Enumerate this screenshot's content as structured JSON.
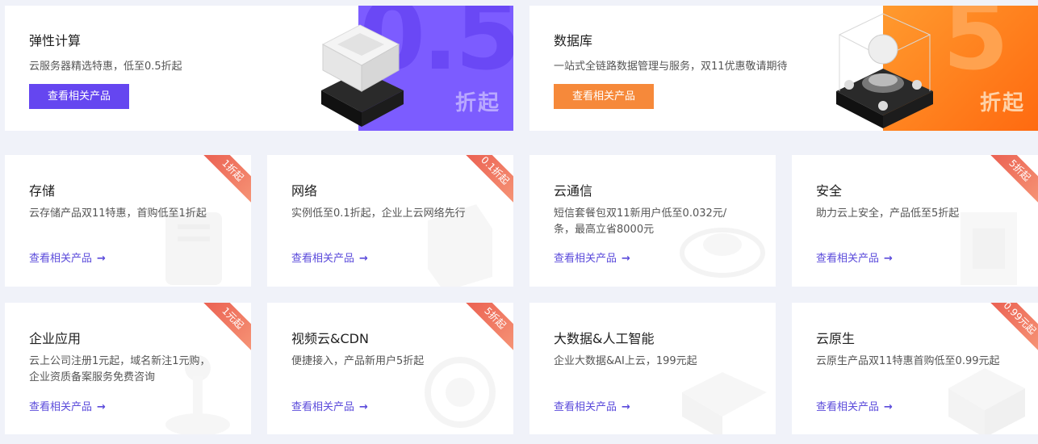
{
  "featured": [
    {
      "title": "弹性计算",
      "desc": "云服务器精选特惠，低至0.5折起",
      "button": "查看相关产品",
      "promo_number": "0.5",
      "promo_suffix": "折起",
      "accent": "#6546f0",
      "promo_bg": "#7c5cff"
    },
    {
      "title": "数据库",
      "desc": "一站式全链路数据管理与服务，双11优惠敬请期待",
      "button": "查看相关产品",
      "promo_number": "5",
      "promo_suffix": "折起",
      "accent": "#f6893a",
      "promo_bg": "#ff7a1f"
    }
  ],
  "products": [
    {
      "title": "存储",
      "desc": "云存储产品双11特惠，首购低至1折起",
      "link": "查看相关产品",
      "badge": "1折起",
      "icon": "storage-icon"
    },
    {
      "title": "网络",
      "desc": "实例低至0.1折起，企业上云网络先行",
      "link": "查看相关产品",
      "badge": "0.1折起",
      "icon": "network-icon"
    },
    {
      "title": "云通信",
      "desc": "短信套餐包双11新用户低至0.032元/条，最高立省8000元",
      "link": "查看相关产品",
      "badge": "",
      "icon": "communication-icon"
    },
    {
      "title": "安全",
      "desc": "助力云上安全，产品低至5折起",
      "link": "查看相关产品",
      "badge": "5折起",
      "icon": "security-icon"
    },
    {
      "title": "企业应用",
      "desc": "云上公司注册1元起，域名新注1元购，企业资质备案服务免费咨询",
      "link": "查看相关产品",
      "badge": "1元起",
      "icon": "enterprise-app-icon"
    },
    {
      "title": "视频云&CDN",
      "desc": "便捷接入，产品新用户5折起",
      "link": "查看相关产品",
      "badge": "5折起",
      "icon": "video-cdn-icon"
    },
    {
      "title": "大数据&人工智能",
      "desc": "企业大数据&AI上云，199元起",
      "link": "查看相关产品",
      "badge": "",
      "icon": "bigdata-ai-icon"
    },
    {
      "title": "云原生",
      "desc": "云原生产品双11特惠首购低至0.99元起",
      "link": "查看相关产品",
      "badge": "0.99元起",
      "icon": "cloud-native-icon"
    }
  ],
  "arrow": "→"
}
